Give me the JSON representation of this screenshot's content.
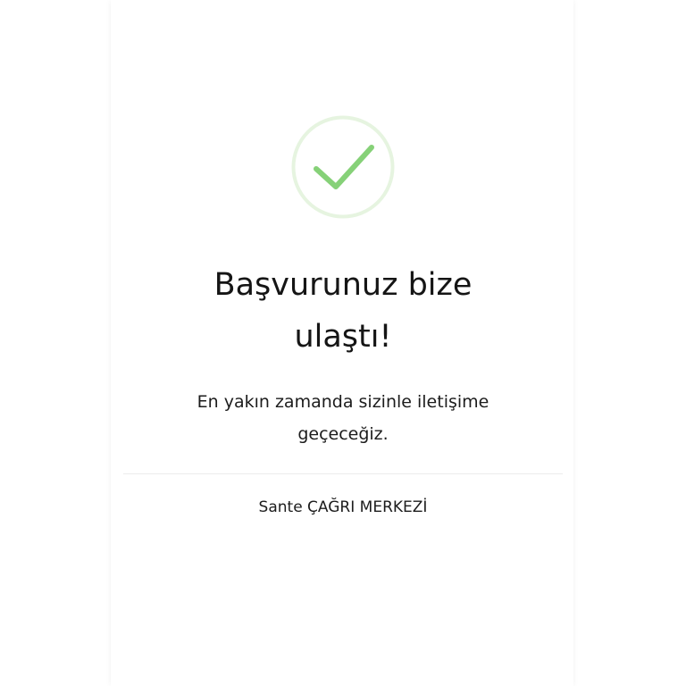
{
  "success": {
    "icon": "checkmark-circle-icon",
    "ring_color": "#e6f4e0",
    "check_color": "#86d178"
  },
  "heading": {
    "line1": "Başvurunuz bize",
    "line2": "ulaştı!"
  },
  "message": {
    "line1": "En yakın zamanda sizinle iletişime",
    "line2": "geçeceğiz."
  },
  "footer": {
    "signature": "Sante ÇAĞRI MERKEZİ"
  }
}
